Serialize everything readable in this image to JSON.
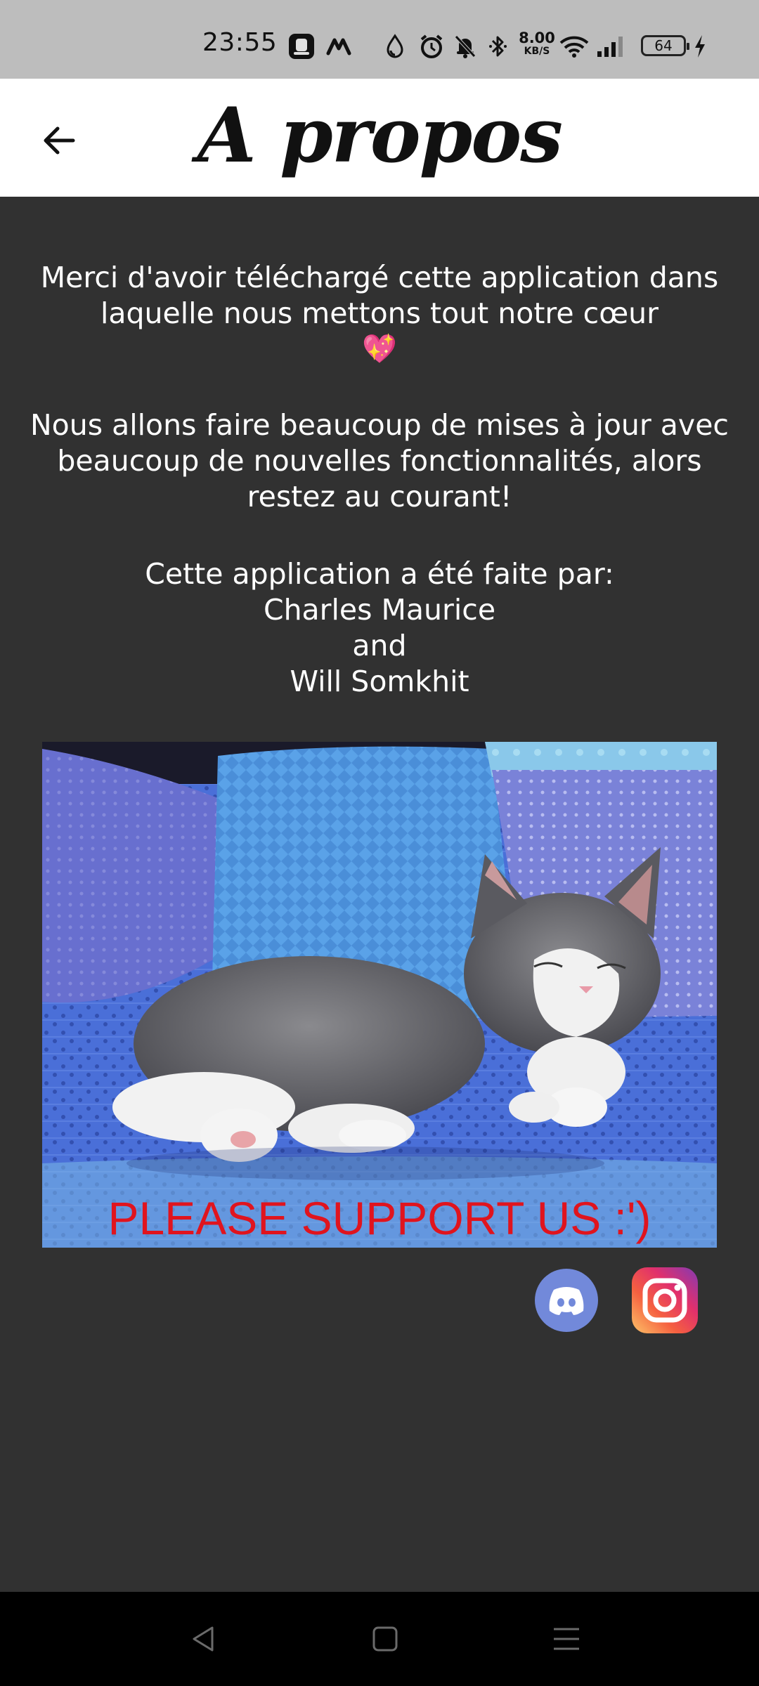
{
  "status_bar": {
    "time": "23:55",
    "net_speed_value": "8.00",
    "net_speed_unit": "KB/S",
    "battery_level": "64",
    "icons": [
      "app-notification-icon",
      "m-logo-icon",
      "drop-icon",
      "alarm-icon",
      "muted-bell-icon",
      "bluetooth-icon",
      "wifi-icon",
      "signal-icon",
      "battery-icon",
      "charging-icon"
    ]
  },
  "header": {
    "title": "A propos",
    "back_icon": "arrow-left-icon"
  },
  "about": {
    "paragraph1": "Merci d'avoir téléchargé cette application dans laquelle nous mettons tout notre cœur",
    "heart_emoji": "💖",
    "paragraph2": "Nous allons faire beaucoup de mises à jour avec beaucoup de nouvelles fonctionnalités, alors restez au courant!",
    "credits_intro": "Cette application a été faite par:",
    "author1": "Charles Maurice",
    "conjunction": "and",
    "author2": "Will Somkhit"
  },
  "image_banner": {
    "overlay_text": "PLEASE SUPPORT US :')",
    "overlay_color": "#e0141e"
  },
  "social": {
    "discord_icon": "discord-icon",
    "instagram_icon": "instagram-icon"
  },
  "nav_bar": {
    "icons": [
      "back-triangle-icon",
      "home-square-icon",
      "menu-lines-icon"
    ]
  },
  "colors": {
    "background": "#313131",
    "header_bg": "#ffffff",
    "status_bar_bg": "#bdbdbd",
    "text": "#ffffff"
  }
}
